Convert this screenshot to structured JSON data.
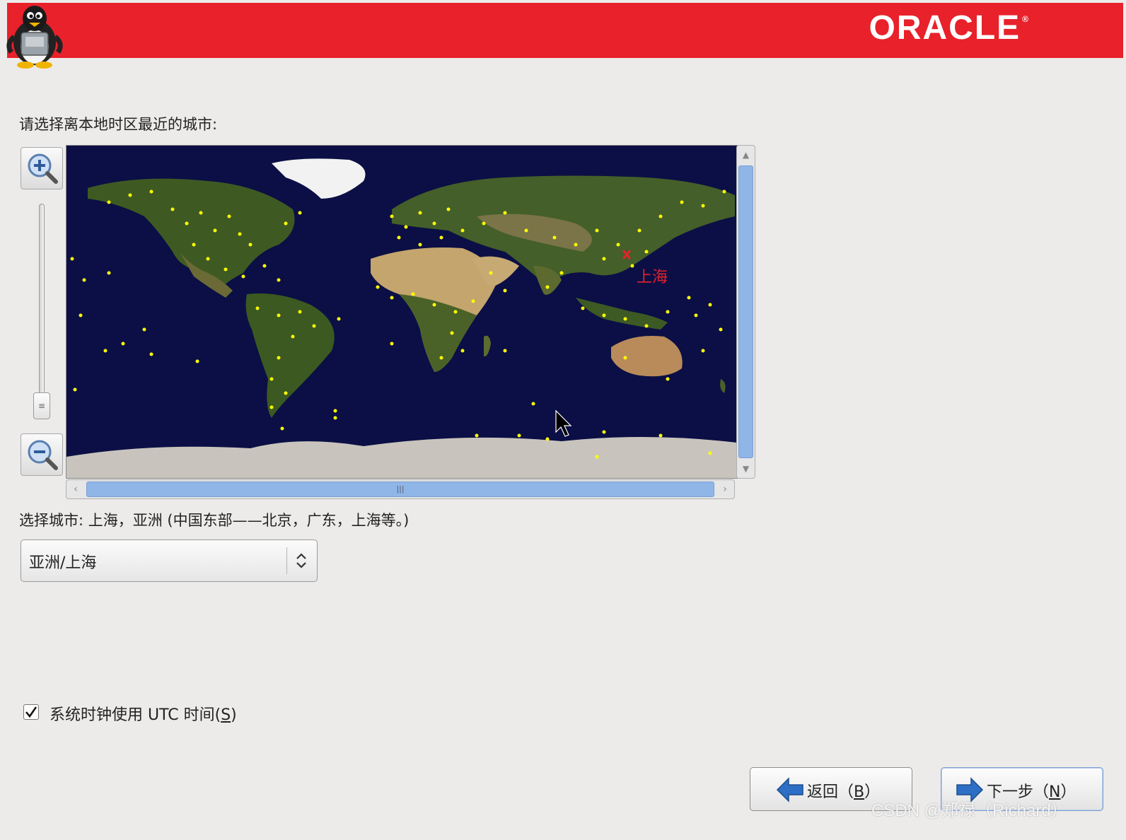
{
  "header": {
    "brand": "ORACLE",
    "brand_mark": "®",
    "mascot_icon": "tux-penguin-icon",
    "color": "#e8212b"
  },
  "map": {
    "prompt": "请选择离本地时区最近的城市:",
    "selected_marker_label": "上海",
    "marker_color": "#ffff00",
    "selected_marker_color": "#e8212b",
    "zoom_in_icon": "zoom-in-icon",
    "zoom_out_icon": "zoom-out-icon"
  },
  "selection": {
    "text": "选择城市: 上海，亚洲 (中国东部——北京，广东，上海等。)",
    "combo_value": "亚洲/上海"
  },
  "utc": {
    "checked": true,
    "label_prefix": "系统时钟使用 UTC 时间(",
    "label_mnemonic": "S",
    "label_suffix": ")"
  },
  "buttons": {
    "back": {
      "label_prefix": "返回（",
      "mnemonic": "B",
      "label_suffix": "）",
      "icon": "arrow-left-icon"
    },
    "next": {
      "label_prefix": "下一步（",
      "mnemonic": "N",
      "label_suffix": "）",
      "icon": "arrow-right-icon"
    }
  },
  "watermark": "CSDN @郑禄（Richard）"
}
